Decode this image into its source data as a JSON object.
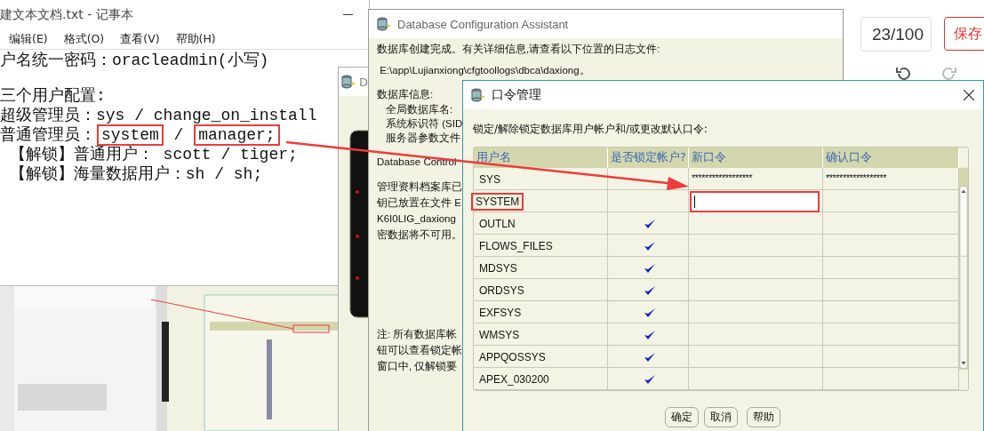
{
  "background_page": {
    "counter": "23/100",
    "save_button": "保存",
    "tools": [
      {
        "kind": "undo",
        "disabled": false
      },
      {
        "kind": "redo",
        "disabled": true
      }
    ]
  },
  "notepad": {
    "title": "建文本文档.txt - 记事本",
    "menu": [
      "编辑(E)",
      "格式(O)",
      "查看(V)",
      "帮助(H)"
    ],
    "paragraphs": [
      [
        [
          {
            "text": "户名统一密码：oracleadmin(小写)",
            "boxed": false
          }
        ]
      ],
      [
        [
          {
            "text": "三个用户配置:",
            "boxed": false
          }
        ],
        [
          {
            "text": "超级管理员：sys / change_on_install",
            "boxed": false
          }
        ],
        [
          {
            "text": "普通管理员：",
            "boxed": false
          },
          {
            "text": "system",
            "boxed": true
          },
          {
            "text": " / ",
            "boxed": false
          },
          {
            "text": "manager;",
            "boxed": true
          }
        ],
        [
          {
            "text": " 【解锁】普通用户： scott / tiger;",
            "boxed": false
          }
        ],
        [
          {
            "text": " 【解锁】海量数据用户：sh / sh;",
            "boxed": false
          }
        ]
      ]
    ]
  },
  "back_window": {
    "title": "D"
  },
  "dca": {
    "title": "Database Configuration Assistant",
    "paragraphs": [
      {
        "kind": "plain",
        "lines": [
          "数据库创建完成。有关详细信息,请查看以下位置的日志文件:",
          " E:\\app\\Lujianxiong\\cfgtoollogs\\dbca\\daxiong。"
        ]
      },
      {
        "kind": "plain",
        "lines": [
          "数据库信息:"
        ],
        "sub_lines": [
          "全局数据库名:",
          "系统标识符 (SID",
          "服务器参数文件"
        ]
      },
      {
        "kind": "plain",
        "lines": [
          "Database Control"
        ]
      },
      {
        "kind": "plain",
        "lines": [
          "管理资料档案库已",
          "钥已放置在文件 E",
          "K6I0LIG_daxiong",
          "密数据将不可用。"
        ]
      },
      {
        "kind": "note",
        "lines": [
          "注: 所有数据库帐",
          "钮可以查看锁定帐",
          "窗口中, 仅解锁要"
        ]
      }
    ]
  },
  "password_dialog": {
    "title": "口令管理",
    "instruction": "锁定/解除锁定数据库用户帐户和/或更改默认口令:",
    "columns": [
      "用户名",
      "是否锁定帐户?",
      "新口令",
      "确认口令"
    ],
    "rows": [
      {
        "user": "SYS",
        "annotated": false,
        "locked": false,
        "editing": false,
        "new_password": "******************",
        "confirm_password": "******************"
      },
      {
        "user": "SYSTEM",
        "annotated": true,
        "locked": false,
        "editing": true
      },
      {
        "user": "OUTLN",
        "annotated": false,
        "locked": true,
        "editing": false
      },
      {
        "user": "FLOWS_FILES",
        "annotated": false,
        "locked": true,
        "editing": false
      },
      {
        "user": "MDSYS",
        "annotated": false,
        "locked": true,
        "editing": false
      },
      {
        "user": "ORDSYS",
        "annotated": false,
        "locked": true,
        "editing": false
      },
      {
        "user": "EXFSYS",
        "annotated": false,
        "locked": true,
        "editing": false
      },
      {
        "user": "WMSYS",
        "annotated": false,
        "locked": true,
        "editing": false
      },
      {
        "user": "APPQOSSYS",
        "annotated": false,
        "locked": true,
        "editing": false
      },
      {
        "user": "APEX_030200",
        "annotated": false,
        "locked": true,
        "editing": false
      }
    ],
    "buttons": [
      "确定",
      "取消",
      "帮助"
    ]
  }
}
